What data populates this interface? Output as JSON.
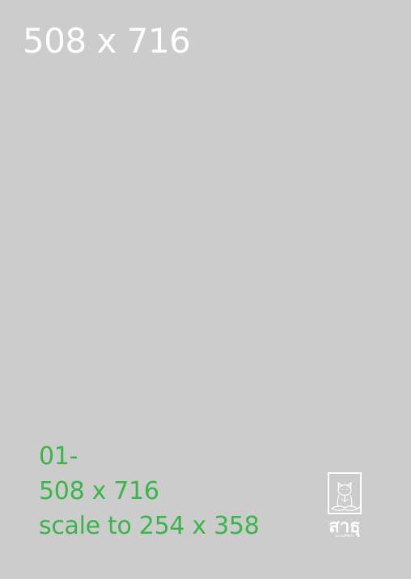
{
  "header": {
    "dimensions_label": "508 x 716"
  },
  "caption": {
    "line1": "01-",
    "line2": "508 x 716",
    "line3": "scale to 254 x 358"
  },
  "logo": {
    "icon": "meditating-cat-icon",
    "wordmark": "สาธุ",
    "subtext": "ทะเบนที่ชัยใจ"
  },
  "colors": {
    "background": "#cccccc",
    "header_text": "#ffffff",
    "caption_text": "#3ab54a",
    "logo": "#ffffff"
  }
}
